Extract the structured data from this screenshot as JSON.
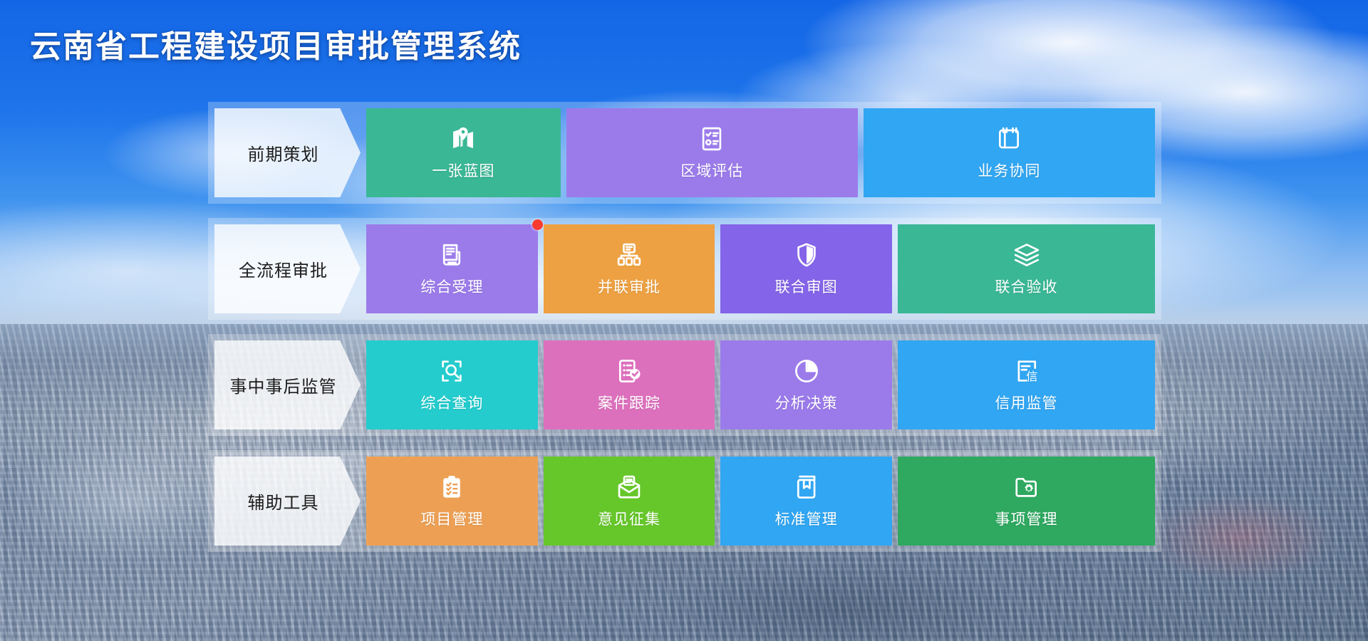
{
  "header": {
    "title": "云南省工程建设项目审批管理系统"
  },
  "rows": [
    {
      "label": "前期策划",
      "cards": [
        {
          "label": "一张蓝图",
          "icon": "map-pin-icon",
          "color": "#3ab795",
          "flex": 2,
          "badge": false
        },
        {
          "label": "区域评估",
          "icon": "checklist-icon",
          "color": "#9b7bea",
          "flex": 3,
          "badge": false
        },
        {
          "label": "业务协同",
          "icon": "book-open-icon",
          "color": "#31a6f2",
          "flex": 3,
          "badge": false
        }
      ]
    },
    {
      "label": "全流程审批",
      "cards": [
        {
          "label": "综合受理",
          "icon": "receipt-icon",
          "color": "#9b7bea",
          "flex": 2,
          "badge": true
        },
        {
          "label": "并联审批",
          "icon": "org-chart-icon",
          "color": "#eda142",
          "flex": 2,
          "badge": false
        },
        {
          "label": "联合审图",
          "icon": "shield-icon",
          "color": "#8464e8",
          "flex": 2,
          "badge": false
        },
        {
          "label": "联合验收",
          "icon": "layers-icon",
          "color": "#3ab795",
          "flex": 3,
          "badge": false
        }
      ]
    },
    {
      "label": "事中事后监管",
      "cards": [
        {
          "label": "综合查询",
          "icon": "search-doc-icon",
          "color": "#24ccce",
          "flex": 2,
          "badge": false
        },
        {
          "label": "案件跟踪",
          "icon": "case-track-icon",
          "color": "#dd70bd",
          "flex": 2,
          "badge": false
        },
        {
          "label": "分析决策",
          "icon": "pie-chart-icon",
          "color": "#9b7bea",
          "flex": 2,
          "badge": false
        },
        {
          "label": "信用监管",
          "icon": "credit-doc-icon",
          "color": "#31a6f2",
          "flex": 3,
          "badge": false
        }
      ]
    },
    {
      "label": "辅助工具",
      "cards": [
        {
          "label": "项目管理",
          "icon": "clipboard-icon",
          "color": "#eda054",
          "flex": 2,
          "badge": false
        },
        {
          "label": "意见征集",
          "icon": "envelope-icon",
          "color": "#66c72a",
          "flex": 2,
          "badge": false
        },
        {
          "label": "标准管理",
          "icon": "book-icon",
          "color": "#31a6f2",
          "flex": 2,
          "badge": false
        },
        {
          "label": "事项管理",
          "icon": "folder-gear-icon",
          "color": "#2fa860",
          "flex": 3,
          "badge": false
        }
      ]
    }
  ],
  "colors": {
    "green": "#3ab795",
    "purple": "#9b7bea",
    "deep_purple": "#8464e8",
    "blue": "#31a6f2",
    "orange": "#eda142",
    "teal": "#24ccce",
    "pink": "#dd70bd",
    "lime": "#66c72a",
    "emerald": "#2fa860",
    "badge_red": "#fb3b30",
    "title_text": "#ffffff",
    "sky_blue": "#1466e6"
  }
}
